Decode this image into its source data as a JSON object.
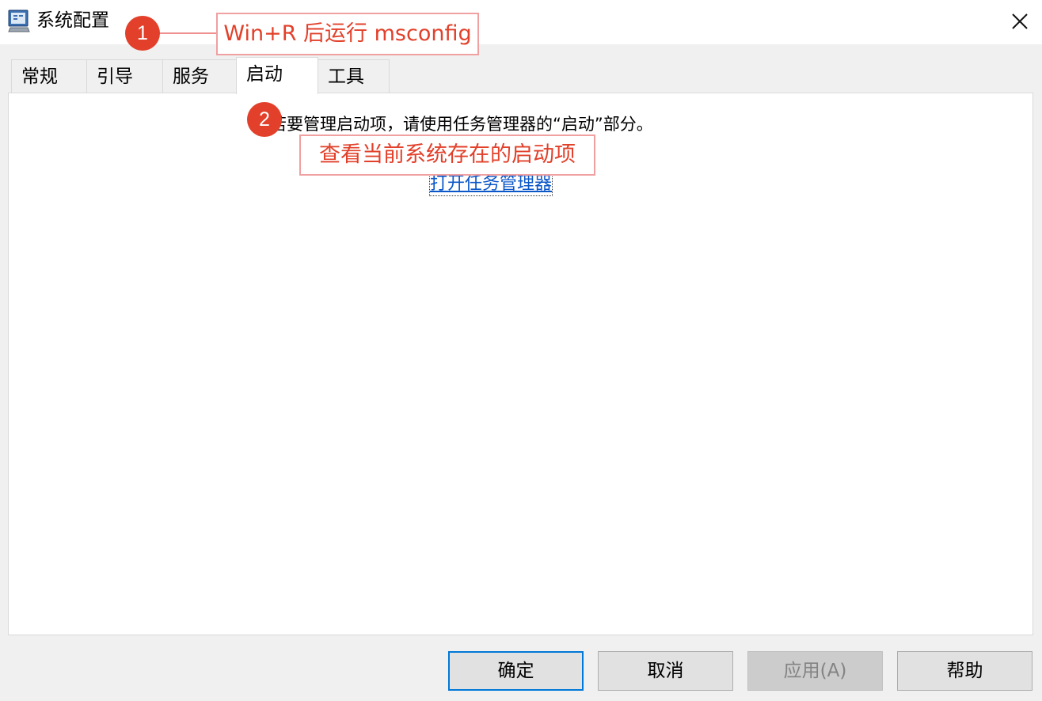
{
  "window": {
    "title": "系统配置",
    "app_icon": "msconfig-monitor-icon",
    "close_icon": "close-icon"
  },
  "tabs": [
    {
      "label": "常规"
    },
    {
      "label": "引导"
    },
    {
      "label": "服务"
    },
    {
      "label": "启动",
      "active": true
    },
    {
      "label": "工具"
    }
  ],
  "panel": {
    "info_text": "若要管理启动项，请使用任务管理器的“启动”部分。",
    "link_text": "打开任务管理器"
  },
  "buttons": {
    "ok": "确定",
    "cancel": "取消",
    "apply": "应用(A)",
    "help": "帮助"
  },
  "annotations": [
    {
      "number": "1",
      "text": "Win+R 后运行 msconfig"
    },
    {
      "number": "2",
      "text": "查看当前系统存在的启动项"
    }
  ],
  "colors": {
    "annotation_red": "#e2402a",
    "link_blue": "#0b57c8",
    "primary_border": "#0078d7"
  }
}
